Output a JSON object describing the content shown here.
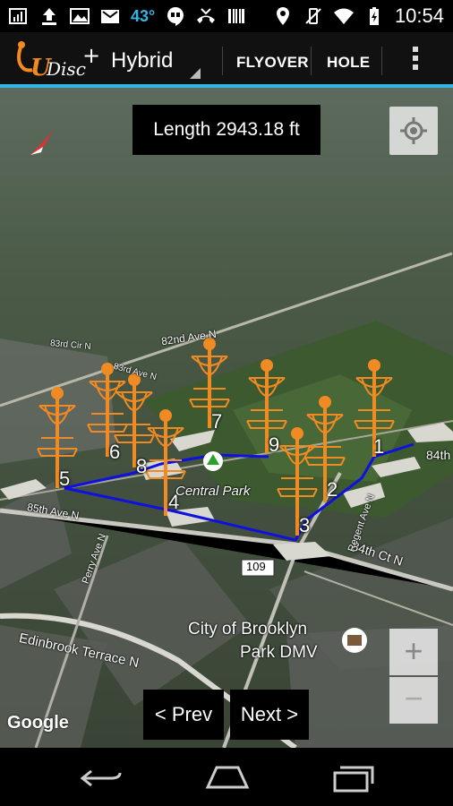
{
  "status_bar": {
    "temperature": "43°",
    "time": "10:54"
  },
  "action_bar": {
    "logo_text": "UDisc",
    "map_mode": "Hybrid",
    "flyover_label": "FLYOVER",
    "hole_label": "HOLE"
  },
  "map": {
    "length_text": "Length 2943.18 ft",
    "park_label": "Central Park",
    "dmv_label": [
      "City of Brooklyn",
      "Park DMV"
    ],
    "road_labels": {
      "road_82nd": "82nd Ave N",
      "road_83rd_cir": "83rd Cir N",
      "road_83rd_ave": "83rd Ave N",
      "road_85th": "85th Ave N",
      "road_84th_ct": "84th Ct N",
      "road_84th": "84th",
      "road_regent": "Regent Ave N",
      "road_perry": "Perry Ave N",
      "road_edinbrook": "Edinbrook Terrace N",
      "highway": "109"
    },
    "holes": [
      "1",
      "2",
      "3",
      "4",
      "5",
      "6",
      "7",
      "8",
      "9"
    ],
    "google": "Google"
  },
  "buttons": {
    "prev": "< Prev",
    "next": "Next >",
    "zoom_in": "+",
    "zoom_out": "−"
  }
}
